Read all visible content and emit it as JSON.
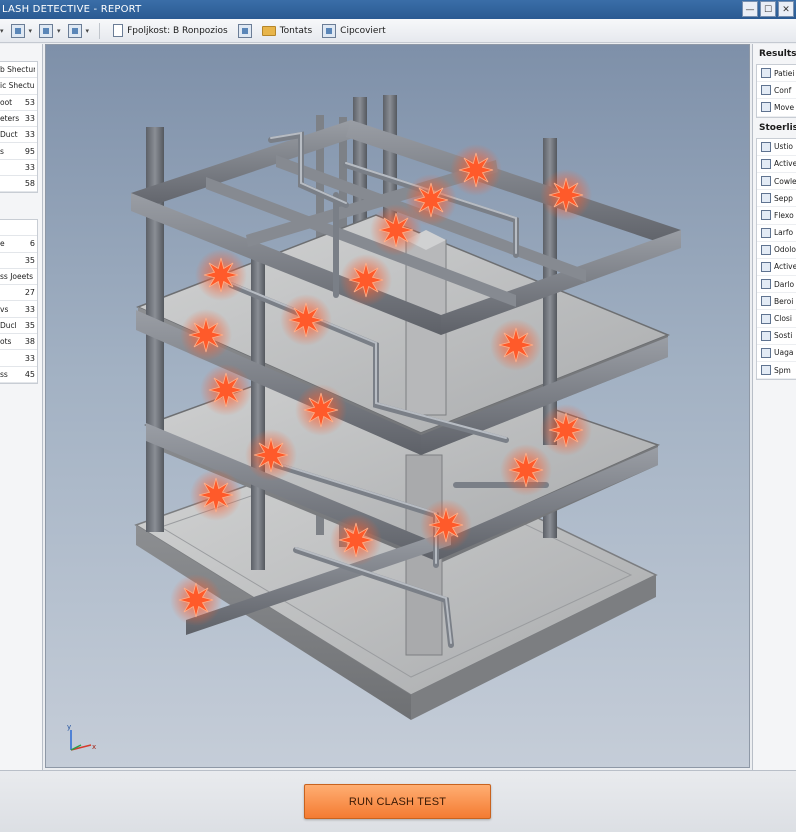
{
  "window": {
    "title": "LASH DETECTIVE - REPORT",
    "minimize_label": "—",
    "maximize_label": "☐",
    "close_label": "✕"
  },
  "toolbar": {
    "item1_label": "Fpoljkost: B Ronpozios",
    "item2_label": "Tontats",
    "item3_label": "Cipcoviert"
  },
  "left_panel": {
    "group1": [
      {
        "name": "b Shecture",
        "value": ""
      },
      {
        "name": "ic Shecture",
        "value": ""
      },
      {
        "name": "oot",
        "value": "53"
      },
      {
        "name": "eters",
        "value": "33"
      },
      {
        "name": "Duct",
        "value": "33"
      },
      {
        "name": "s",
        "value": "95"
      },
      {
        "name": "",
        "value": "33"
      },
      {
        "name": "",
        "value": "58"
      }
    ],
    "group2": [
      {
        "name": "",
        "value": ""
      },
      {
        "name": "e",
        "value": "6"
      },
      {
        "name": "",
        "value": "35"
      },
      {
        "name": "ss Joeets",
        "value": ""
      },
      {
        "name": "",
        "value": "27"
      },
      {
        "name": "vs",
        "value": "33"
      },
      {
        "name": "Ducl",
        "value": "35"
      },
      {
        "name": "ots",
        "value": "38"
      },
      {
        "name": "",
        "value": "33"
      },
      {
        "name": "ss",
        "value": "45"
      }
    ]
  },
  "right_panel": {
    "results_heading": "Results",
    "results": [
      {
        "label": "Patiei",
        "icon": "document-icon"
      },
      {
        "label": "Conf",
        "icon": "document-icon"
      },
      {
        "label": "Move",
        "icon": "document-icon"
      }
    ],
    "status_heading": "Stoerlis",
    "status": [
      {
        "label": "Ustio",
        "icon": "cross-icon"
      },
      {
        "label": "Active",
        "icon": "pencil-icon"
      },
      {
        "label": "Cowle",
        "icon": "pipe-icon"
      },
      {
        "label": "Sepp",
        "icon": "pipe-icon"
      },
      {
        "label": "Flexo",
        "icon": "document-icon"
      },
      {
        "label": "Larfo",
        "icon": "grid-icon"
      },
      {
        "label": "Odolo",
        "icon": "document-icon"
      },
      {
        "label": "Active",
        "icon": "document-icon"
      },
      {
        "label": "Darlo",
        "icon": "pencil-icon"
      },
      {
        "label": "Beroi",
        "icon": "grid-icon"
      },
      {
        "label": "Closi",
        "icon": "checkbox-icon"
      },
      {
        "label": "Sosti",
        "icon": "grid-icon"
      },
      {
        "label": "Uaga",
        "icon": "pencil-icon"
      },
      {
        "label": "Spm",
        "icon": "comment-icon"
      }
    ]
  },
  "viewport": {
    "axis_y": "y",
    "axis_x": "x",
    "accent_clash": "#ff5a2a",
    "steel_color": "#7c8087",
    "concrete_color": "#b9bbbd"
  },
  "footer": {
    "run_button_label": "RUN CLASH TEST"
  }
}
